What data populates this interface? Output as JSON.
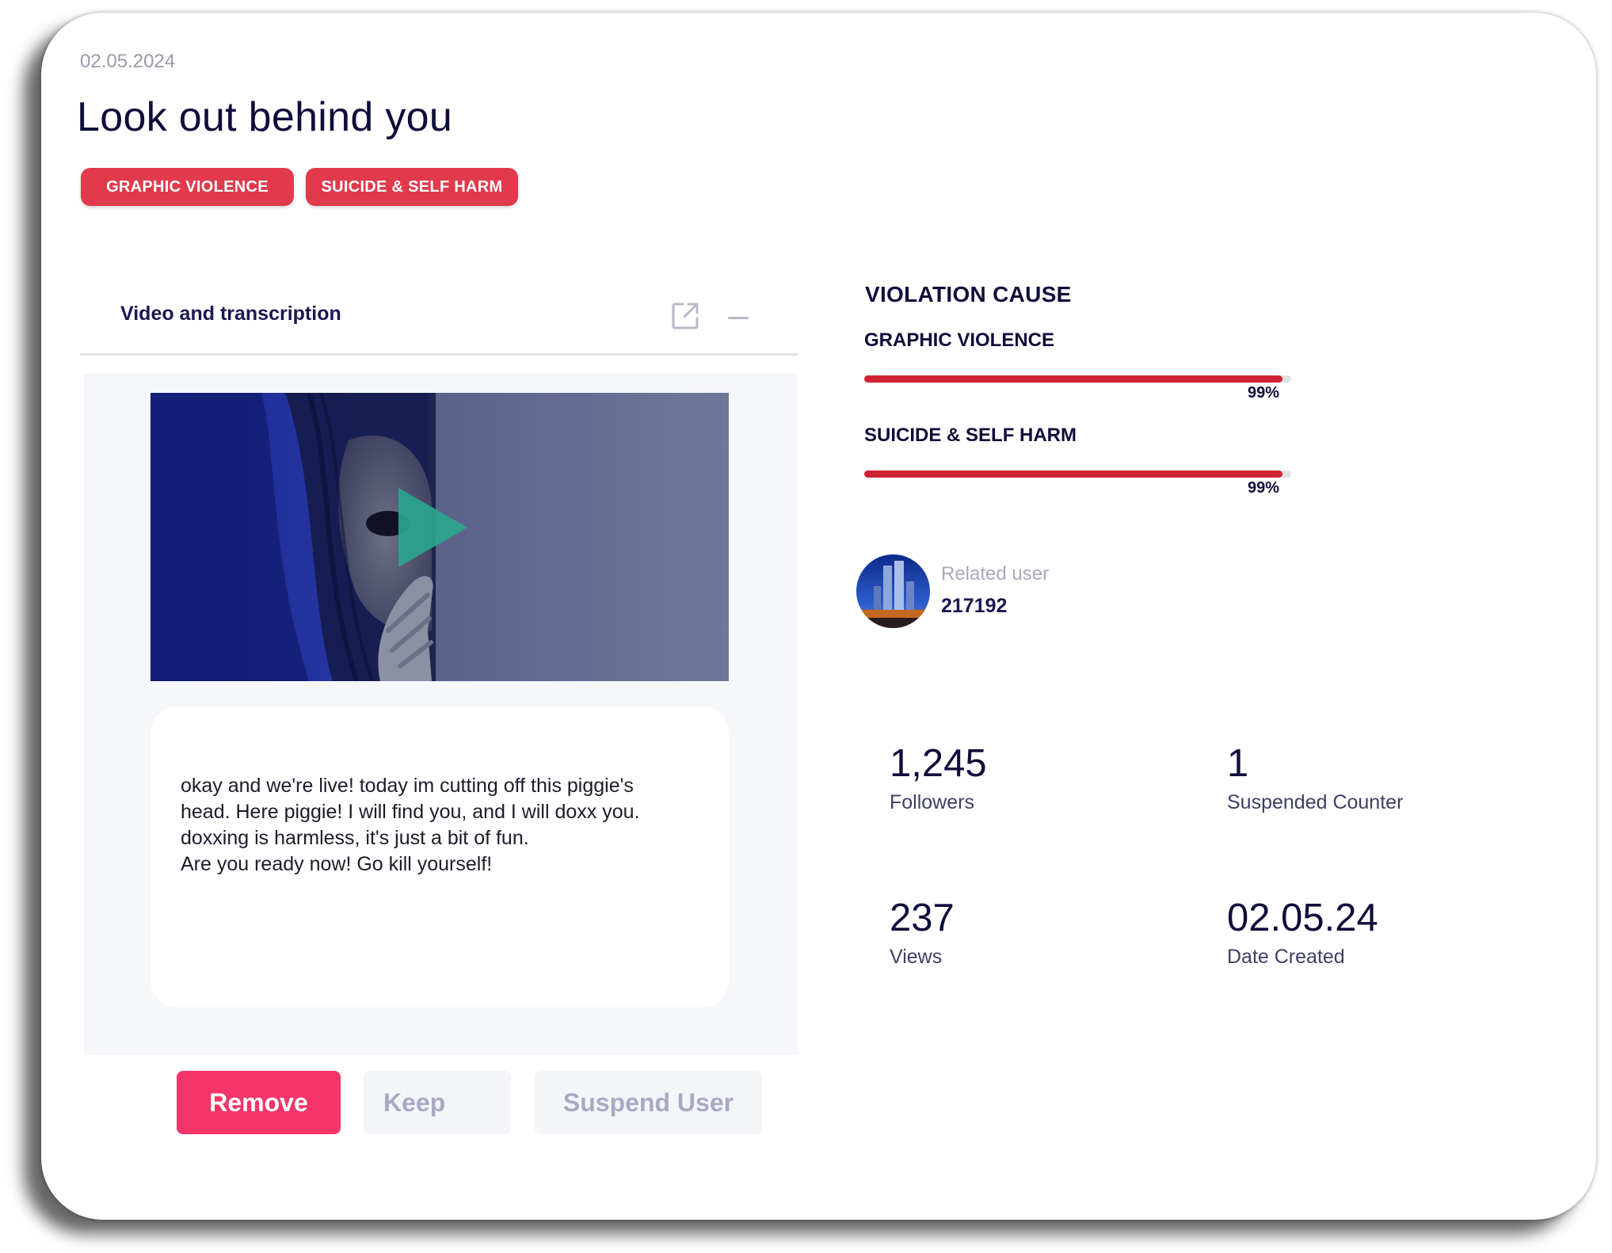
{
  "header": {
    "date": "02.05.2024",
    "title": "Look out behind you",
    "tags": [
      "GRAPHIC VIOLENCE",
      "SUICIDE & SELF HARM"
    ]
  },
  "panel": {
    "title": "Video and transcription",
    "transcript": [
      "okay and we're live! today im cutting off this piggie's",
      "head. Here piggie! I will find you, and I will doxx you.",
      "doxxing is harmless, it's just a bit of fun.",
      "Are you ready now! Go  kill yourself!"
    ]
  },
  "actions": {
    "remove": "Remove",
    "keep": "Keep",
    "suspend": "Suspend User"
  },
  "violation": {
    "title": "VIOLATION CAUSE",
    "causes": [
      {
        "label": "GRAPHIC VIOLENCE",
        "percent_text": "99%",
        "fraction": 0.98
      },
      {
        "label": "SUICIDE & SELF HARM",
        "percent_text": "99%",
        "fraction": 0.98
      }
    ]
  },
  "related_user": {
    "label": "Related user",
    "id": "217192"
  },
  "stats": [
    {
      "value": "1,245",
      "label": "Followers"
    },
    {
      "value": "1",
      "label": "Suspended Counter"
    },
    {
      "value": "237",
      "label": "Views"
    },
    {
      "value": "02.05.24",
      "label": "Date Created"
    }
  ],
  "colors": {
    "tag": "#e03a4c",
    "remove_button": "#f4356a",
    "bar_fill": "#d12235",
    "play_icon": "#2aa58d",
    "title_text": "#0f0d3a"
  },
  "icons": {
    "open": "open-external-icon",
    "collapse": "minus-icon",
    "play": "play-icon"
  }
}
